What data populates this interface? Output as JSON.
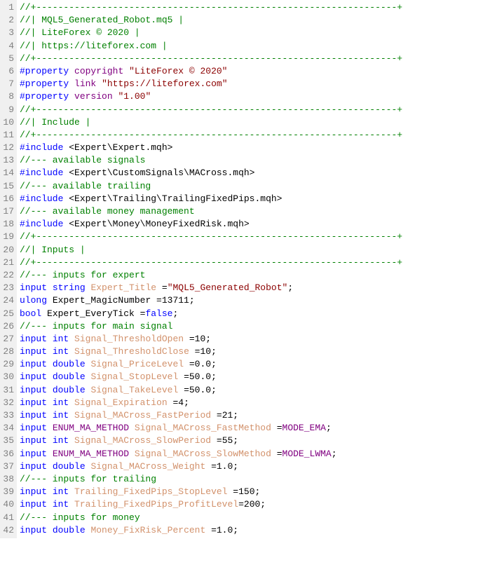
{
  "lines": [
    {
      "num": "1",
      "tokens": [
        {
          "cls": "c-comment",
          "text": "//+------------------------------------------------------------------+"
        }
      ]
    },
    {
      "num": "2",
      "tokens": [
        {
          "cls": "c-comment",
          "text": "//|                                     MQL5_Generated_Robot.mq5 |"
        }
      ]
    },
    {
      "num": "3",
      "tokens": [
        {
          "cls": "c-comment",
          "text": "//|                                             LiteForex © 2020 |"
        }
      ]
    },
    {
      "num": "4",
      "tokens": [
        {
          "cls": "c-comment",
          "text": "//|                                        https://liteforex.com |"
        }
      ]
    },
    {
      "num": "5",
      "tokens": [
        {
          "cls": "c-comment",
          "text": "//+------------------------------------------------------------------+"
        }
      ]
    },
    {
      "num": "6",
      "tokens": [
        {
          "cls": "c-keyword",
          "text": "#property"
        },
        {
          "cls": "",
          "text": " "
        },
        {
          "cls": "c-property",
          "text": "copyright"
        },
        {
          "cls": "",
          "text": " "
        },
        {
          "cls": "c-string",
          "text": "\"LiteForex © 2020\""
        }
      ]
    },
    {
      "num": "7",
      "tokens": [
        {
          "cls": "c-keyword",
          "text": "#property"
        },
        {
          "cls": "",
          "text": " "
        },
        {
          "cls": "c-property",
          "text": "link"
        },
        {
          "cls": "",
          "text": "      "
        },
        {
          "cls": "c-string",
          "text": "\"https://liteforex.com\""
        }
      ]
    },
    {
      "num": "8",
      "tokens": [
        {
          "cls": "c-keyword",
          "text": "#property"
        },
        {
          "cls": "",
          "text": " "
        },
        {
          "cls": "c-property",
          "text": "version"
        },
        {
          "cls": "",
          "text": "   "
        },
        {
          "cls": "c-string",
          "text": "\"1.00\""
        }
      ]
    },
    {
      "num": "9",
      "tokens": [
        {
          "cls": "c-comment",
          "text": "//+------------------------------------------------------------------+"
        }
      ]
    },
    {
      "num": "10",
      "tokens": [
        {
          "cls": "c-comment",
          "text": "//| Include                                                          |"
        }
      ]
    },
    {
      "num": "11",
      "tokens": [
        {
          "cls": "c-comment",
          "text": "//+------------------------------------------------------------------+"
        }
      ]
    },
    {
      "num": "12",
      "tokens": [
        {
          "cls": "c-keyword",
          "text": "#include"
        },
        {
          "cls": "",
          "text": " "
        },
        {
          "cls": "c-include-path",
          "text": "<Expert\\Expert.mqh>"
        }
      ]
    },
    {
      "num": "13",
      "tokens": [
        {
          "cls": "c-comment",
          "text": "//--- available signals"
        }
      ]
    },
    {
      "num": "14",
      "tokens": [
        {
          "cls": "c-keyword",
          "text": "#include"
        },
        {
          "cls": "",
          "text": " "
        },
        {
          "cls": "c-include-path",
          "text": "<Expert\\CustomSignals\\MACross.mqh>"
        }
      ]
    },
    {
      "num": "15",
      "tokens": [
        {
          "cls": "c-comment",
          "text": "//--- available trailing"
        }
      ]
    },
    {
      "num": "16",
      "tokens": [
        {
          "cls": "c-keyword",
          "text": "#include"
        },
        {
          "cls": "",
          "text": " "
        },
        {
          "cls": "c-include-path",
          "text": "<Expert\\Trailing\\TrailingFixedPips.mqh>"
        }
      ]
    },
    {
      "num": "17",
      "tokens": [
        {
          "cls": "c-comment",
          "text": "//--- available money management"
        }
      ]
    },
    {
      "num": "18",
      "tokens": [
        {
          "cls": "c-keyword",
          "text": "#include"
        },
        {
          "cls": "",
          "text": " "
        },
        {
          "cls": "c-include-path",
          "text": "<Expert\\Money\\MoneyFixedRisk.mqh>"
        }
      ]
    },
    {
      "num": "19",
      "tokens": [
        {
          "cls": "c-comment",
          "text": "//+------------------------------------------------------------------+"
        }
      ]
    },
    {
      "num": "20",
      "tokens": [
        {
          "cls": "c-comment",
          "text": "//| Inputs                                                           |"
        }
      ]
    },
    {
      "num": "21",
      "tokens": [
        {
          "cls": "c-comment",
          "text": "//+------------------------------------------------------------------+"
        }
      ]
    },
    {
      "num": "22",
      "tokens": [
        {
          "cls": "c-comment",
          "text": "//--- inputs for expert"
        }
      ]
    },
    {
      "num": "23",
      "tokens": [
        {
          "cls": "c-keyword",
          "text": "input"
        },
        {
          "cls": "",
          "text": " "
        },
        {
          "cls": "c-type",
          "text": "string"
        },
        {
          "cls": "",
          "text": "          "
        },
        {
          "cls": "c-identifier",
          "text": "Expert_Title"
        },
        {
          "cls": "",
          "text": "                  ="
        },
        {
          "cls": "c-string",
          "text": "\"MQL5_Generated_Robot\""
        },
        {
          "cls": "",
          "text": ";"
        }
      ]
    },
    {
      "num": "24",
      "tokens": [
        {
          "cls": "c-type",
          "text": "ulong"
        },
        {
          "cls": "",
          "text": "                 Expert_MagicNumber            =13711;"
        }
      ]
    },
    {
      "num": "25",
      "tokens": [
        {
          "cls": "c-type",
          "text": "bool"
        },
        {
          "cls": "",
          "text": "                  Expert_EveryTick              ="
        },
        {
          "cls": "c-false",
          "text": "false"
        },
        {
          "cls": "",
          "text": ";"
        }
      ]
    },
    {
      "num": "26",
      "tokens": [
        {
          "cls": "c-comment",
          "text": "//--- inputs for main signal"
        }
      ]
    },
    {
      "num": "27",
      "tokens": [
        {
          "cls": "c-keyword",
          "text": "input"
        },
        {
          "cls": "",
          "text": " "
        },
        {
          "cls": "c-type",
          "text": "int"
        },
        {
          "cls": "",
          "text": "             "
        },
        {
          "cls": "c-identifier",
          "text": "Signal_ThresholdOpen"
        },
        {
          "cls": "",
          "text": "          =10;"
        }
      ]
    },
    {
      "num": "28",
      "tokens": [
        {
          "cls": "c-keyword",
          "text": "input"
        },
        {
          "cls": "",
          "text": " "
        },
        {
          "cls": "c-type",
          "text": "int"
        },
        {
          "cls": "",
          "text": "             "
        },
        {
          "cls": "c-identifier",
          "text": "Signal_ThresholdClose"
        },
        {
          "cls": "",
          "text": "         =10;"
        }
      ]
    },
    {
      "num": "29",
      "tokens": [
        {
          "cls": "c-keyword",
          "text": "input"
        },
        {
          "cls": "",
          "text": " "
        },
        {
          "cls": "c-type",
          "text": "double"
        },
        {
          "cls": "",
          "text": "          "
        },
        {
          "cls": "c-identifier",
          "text": "Signal_PriceLevel"
        },
        {
          "cls": "",
          "text": "             =0.0;"
        }
      ]
    },
    {
      "num": "30",
      "tokens": [
        {
          "cls": "c-keyword",
          "text": "input"
        },
        {
          "cls": "",
          "text": " "
        },
        {
          "cls": "c-type",
          "text": "double"
        },
        {
          "cls": "",
          "text": "          "
        },
        {
          "cls": "c-identifier",
          "text": "Signal_StopLevel"
        },
        {
          "cls": "",
          "text": "              =50.0;"
        }
      ]
    },
    {
      "num": "31",
      "tokens": [
        {
          "cls": "c-keyword",
          "text": "input"
        },
        {
          "cls": "",
          "text": " "
        },
        {
          "cls": "c-type",
          "text": "double"
        },
        {
          "cls": "",
          "text": "          "
        },
        {
          "cls": "c-identifier",
          "text": "Signal_TakeLevel"
        },
        {
          "cls": "",
          "text": "              =50.0;"
        }
      ]
    },
    {
      "num": "32",
      "tokens": [
        {
          "cls": "c-keyword",
          "text": "input"
        },
        {
          "cls": "",
          "text": " "
        },
        {
          "cls": "c-type",
          "text": "int"
        },
        {
          "cls": "",
          "text": "             "
        },
        {
          "cls": "c-identifier",
          "text": "Signal_Expiration"
        },
        {
          "cls": "",
          "text": "             =4;"
        }
      ]
    },
    {
      "num": "33",
      "tokens": [
        {
          "cls": "c-keyword",
          "text": "input"
        },
        {
          "cls": "",
          "text": " "
        },
        {
          "cls": "c-type",
          "text": "int"
        },
        {
          "cls": "",
          "text": "             "
        },
        {
          "cls": "c-identifier",
          "text": "Signal_MACross_FastPeriod"
        },
        {
          "cls": "",
          "text": "     =21;"
        }
      ]
    },
    {
      "num": "34",
      "tokens": [
        {
          "cls": "c-keyword",
          "text": "input"
        },
        {
          "cls": "",
          "text": " "
        },
        {
          "cls": "c-enum",
          "text": "ENUM_MA_METHOD"
        },
        {
          "cls": "",
          "text": "  "
        },
        {
          "cls": "c-identifier",
          "text": "Signal_MACross_FastMethod"
        },
        {
          "cls": "",
          "text": "     ="
        },
        {
          "cls": "c-enum",
          "text": "MODE_EMA"
        },
        {
          "cls": "",
          "text": ";"
        }
      ]
    },
    {
      "num": "35",
      "tokens": [
        {
          "cls": "c-keyword",
          "text": "input"
        },
        {
          "cls": "",
          "text": " "
        },
        {
          "cls": "c-type",
          "text": "int"
        },
        {
          "cls": "",
          "text": "             "
        },
        {
          "cls": "c-identifier",
          "text": "Signal_MACross_SlowPeriod"
        },
        {
          "cls": "",
          "text": "     =55;"
        }
      ]
    },
    {
      "num": "36",
      "tokens": [
        {
          "cls": "c-keyword",
          "text": "input"
        },
        {
          "cls": "",
          "text": " "
        },
        {
          "cls": "c-enum",
          "text": "ENUM_MA_METHOD"
        },
        {
          "cls": "",
          "text": "  "
        },
        {
          "cls": "c-identifier",
          "text": "Signal_MACross_SlowMethod"
        },
        {
          "cls": "",
          "text": "     ="
        },
        {
          "cls": "c-enum",
          "text": "MODE_LWMA"
        },
        {
          "cls": "",
          "text": ";"
        }
      ]
    },
    {
      "num": "37",
      "tokens": [
        {
          "cls": "c-keyword",
          "text": "input"
        },
        {
          "cls": "",
          "text": " "
        },
        {
          "cls": "c-type",
          "text": "double"
        },
        {
          "cls": "",
          "text": "          "
        },
        {
          "cls": "c-identifier",
          "text": "Signal_MACross_Weight"
        },
        {
          "cls": "",
          "text": "         =1.0;"
        }
      ]
    },
    {
      "num": "38",
      "tokens": [
        {
          "cls": "c-comment",
          "text": "//--- inputs for trailing"
        }
      ]
    },
    {
      "num": "39",
      "tokens": [
        {
          "cls": "c-keyword",
          "text": "input"
        },
        {
          "cls": "",
          "text": " "
        },
        {
          "cls": "c-type",
          "text": "int"
        },
        {
          "cls": "",
          "text": "             "
        },
        {
          "cls": "c-identifier",
          "text": "Trailing_FixedPips_StopLevel"
        },
        {
          "cls": "",
          "text": "  =150;"
        }
      ]
    },
    {
      "num": "40",
      "tokens": [
        {
          "cls": "c-keyword",
          "text": "input"
        },
        {
          "cls": "",
          "text": " "
        },
        {
          "cls": "c-type",
          "text": "int"
        },
        {
          "cls": "",
          "text": "             "
        },
        {
          "cls": "c-identifier",
          "text": "Trailing_FixedPips_ProfitLevel"
        },
        {
          "cls": "",
          "text": "=200;"
        }
      ]
    },
    {
      "num": "41",
      "tokens": [
        {
          "cls": "c-comment",
          "text": "//--- inputs for money"
        }
      ]
    },
    {
      "num": "42",
      "tokens": [
        {
          "cls": "c-keyword",
          "text": "input"
        },
        {
          "cls": "",
          "text": " "
        },
        {
          "cls": "c-type",
          "text": "double"
        },
        {
          "cls": "",
          "text": "          "
        },
        {
          "cls": "c-identifier",
          "text": "Money_FixRisk_Percent"
        },
        {
          "cls": "",
          "text": "         =1.0;"
        }
      ]
    }
  ]
}
